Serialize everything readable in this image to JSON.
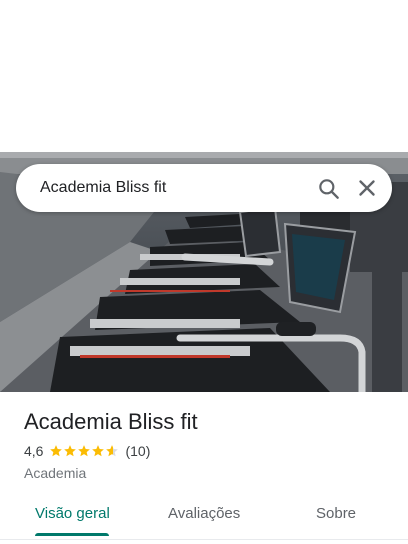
{
  "search": {
    "query": "Academia Bliss fit",
    "search_icon": "search-icon",
    "close_icon": "close-icon"
  },
  "place": {
    "name": "Academia Bliss fit",
    "rating": "4,6",
    "rating_value": 4.6,
    "star_count": 5,
    "reviews": "(10)",
    "category": "Academia"
  },
  "tabs": [
    {
      "label": "Visão geral",
      "selected": true
    },
    {
      "label": "Avaliações",
      "selected": false
    },
    {
      "label": "Sobre",
      "selected": false
    }
  ],
  "colors": {
    "accent": "#00796b",
    "star": "#fbbc04",
    "star_empty": "#dadce0",
    "text_primary": "#202124",
    "text_secondary": "#70757a"
  }
}
